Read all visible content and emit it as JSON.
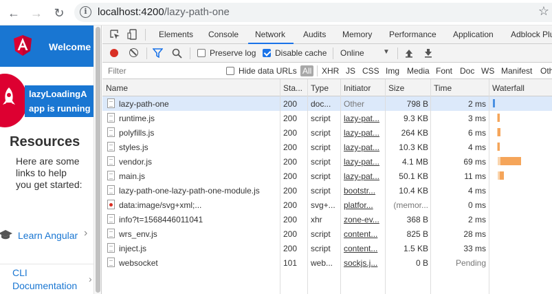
{
  "browser": {
    "url_host": "localhost:4200",
    "url_path": "/lazy-path-one"
  },
  "app": {
    "welcome": "Welcome",
    "banner_line1": "lazyLoadingA",
    "banner_line2": "app is running",
    "resources_title": "Resources",
    "resources_desc": "Here are some links to help you get started:",
    "learn_angular": "Learn Angular",
    "cli_docs": "CLI Documentation",
    "colors": {
      "header": "#1976d2",
      "accent": "#dd0031"
    }
  },
  "devtools": {
    "tabs": [
      "Elements",
      "Console",
      "Network",
      "Audits",
      "Memory",
      "Performance",
      "Application",
      "Adblock Plu"
    ],
    "active_tab": "Network",
    "toolbar": {
      "preserve_log": "Preserve log",
      "disable_cache": "Disable cache",
      "throttle": "Online"
    },
    "filter": {
      "placeholder": "Filter",
      "hide_data_urls": "Hide data URLs",
      "all": "All",
      "types": [
        "XHR",
        "JS",
        "CSS",
        "Img",
        "Media",
        "Font",
        "Doc",
        "WS",
        "Manifest",
        "Oth"
      ]
    },
    "columns": [
      "Name",
      "Sta...",
      "Type",
      "Initiator",
      "Size",
      "Time",
      "Waterfall"
    ],
    "rows": [
      {
        "name": "lazy-path-one",
        "status": "200",
        "type": "doc...",
        "initiator": "Other",
        "size": "798 B",
        "time": "2 ms",
        "icon": "file-icon"
      },
      {
        "name": "runtime.js",
        "status": "200",
        "type": "script",
        "initiator": "lazy-pat...",
        "size": "9.3 KB",
        "time": "3 ms",
        "icon": "file-icon"
      },
      {
        "name": "polyfills.js",
        "status": "200",
        "type": "script",
        "initiator": "lazy-pat...",
        "size": "264 KB",
        "time": "6 ms",
        "icon": "file-icon"
      },
      {
        "name": "styles.js",
        "status": "200",
        "type": "script",
        "initiator": "lazy-pat...",
        "size": "10.3 KB",
        "time": "4 ms",
        "icon": "file-icon"
      },
      {
        "name": "vendor.js",
        "status": "200",
        "type": "script",
        "initiator": "lazy-pat...",
        "size": "4.1 MB",
        "time": "69 ms",
        "icon": "file-icon"
      },
      {
        "name": "main.js",
        "status": "200",
        "type": "script",
        "initiator": "lazy-pat...",
        "size": "50.1 KB",
        "time": "11 ms",
        "icon": "file-icon"
      },
      {
        "name": "lazy-path-one-lazy-path-one-module.js",
        "status": "200",
        "type": "script",
        "initiator": "bootstr...",
        "size": "10.4 KB",
        "time": "4 ms",
        "icon": "file-icon"
      },
      {
        "name": "data:image/svg+xml;...",
        "status": "200",
        "type": "svg+...",
        "initiator": "platfor...",
        "size": "(memor...",
        "time": "0 ms",
        "icon": "image-icon"
      },
      {
        "name": "info?t=1568446011041",
        "status": "200",
        "type": "xhr",
        "initiator": "zone-ev...",
        "size": "368 B",
        "time": "2 ms",
        "icon": "file-icon"
      },
      {
        "name": "wrs_env.js",
        "status": "200",
        "type": "script",
        "initiator": "content...",
        "size": "825 B",
        "time": "28 ms",
        "icon": "file-icon"
      },
      {
        "name": "inject.js",
        "status": "200",
        "type": "script",
        "initiator": "content...",
        "size": "1.5 KB",
        "time": "33 ms",
        "icon": "file-icon"
      },
      {
        "name": "websocket",
        "status": "101",
        "type": "web...",
        "initiator": "sockjs.j...",
        "size": "0 B",
        "time": "Pending",
        "icon": "file-icon"
      }
    ]
  }
}
